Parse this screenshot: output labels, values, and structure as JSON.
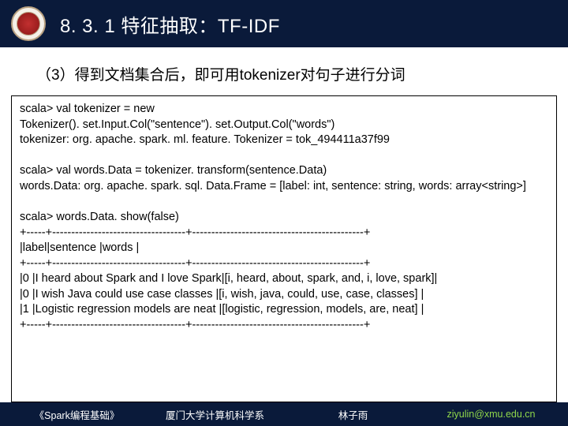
{
  "header": {
    "title": "8. 3. 1 特征抽取：TF-IDF"
  },
  "subtitle": "（3）得到文档集合后，即可用tokenizer对句子进行分词",
  "code": "scala> val tokenizer = new\nTokenizer(). set.Input.Col(\"sentence\"). set.Output.Col(\"words\")\ntokenizer: org. apache. spark. ml. feature. Tokenizer = tok_494411a37f99\n\nscala> val words.Data = tokenizer. transform(sentence.Data)\nwords.Data: org. apache. spark. sql. Data.Frame = [label: int, sentence: string, words: array<string>]\n\nscala> words.Data. show(false)\n+-----+-----------------------------------+---------------------------------------------+\n|label|sentence |words |\n+-----+-----------------------------------+---------------------------------------------+\n|0 |I heard about Spark and I love Spark|[i, heard, about, spark, and, i, love, spark]|\n|0 |I wish Java could use case classes |[i, wish, java, could, use, case, classes] |\n|1 |Logistic regression models are neat |[logistic, regression, models, are, neat] |\n+-----+-----------------------------------+---------------------------------------------+",
  "footer": {
    "book": "《Spark编程基础》",
    "dept": "厦门大学计算机科学系",
    "author": "林子雨",
    "email": "ziyulin@xmu.edu.cn"
  }
}
